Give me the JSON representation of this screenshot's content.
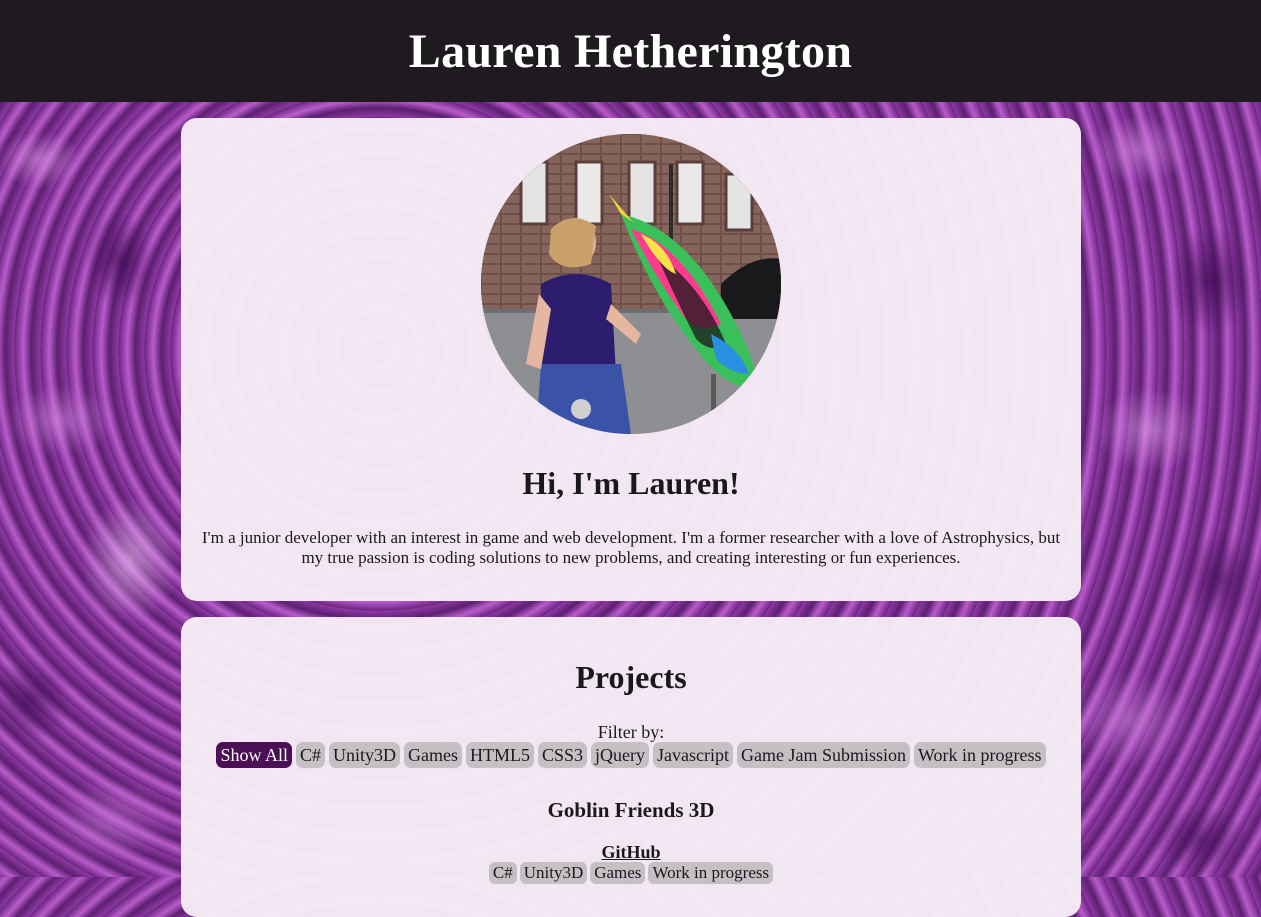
{
  "header": {
    "title": "Lauren Hetherington"
  },
  "about": {
    "photo_icon": "profile-photo",
    "heading": "Hi, I'm Lauren!",
    "text": "I'm a junior developer with an interest in game and web development. I'm a former researcher with a love of Astrophysics, but my true passion is coding solutions to new problems, and creating interesting or fun experiences."
  },
  "projects": {
    "heading": "Projects",
    "filter_label": "Filter by:",
    "filters": [
      {
        "label": "Show All",
        "active": true
      },
      {
        "label": "C#",
        "active": false
      },
      {
        "label": "Unity3D",
        "active": false
      },
      {
        "label": "Games",
        "active": false
      },
      {
        "label": "HTML5",
        "active": false
      },
      {
        "label": "CSS3",
        "active": false
      },
      {
        "label": "jQuery",
        "active": false
      },
      {
        "label": "Javascript",
        "active": false
      },
      {
        "label": "Game Jam Submission",
        "active": false
      },
      {
        "label": "Work in progress",
        "active": false
      }
    ],
    "items": [
      {
        "title": "Goblin Friends 3D",
        "link_label": "GitHub",
        "tags": [
          "C#",
          "Unity3D",
          "Games",
          "Work in progress"
        ]
      }
    ]
  },
  "colors": {
    "header_bg": "#1e1a1f",
    "card_bg": "#f8f0f8",
    "chip_bg": "#c4c0c4",
    "chip_active_bg": "#4b0f55",
    "page_bg": "#7a2a8f"
  }
}
